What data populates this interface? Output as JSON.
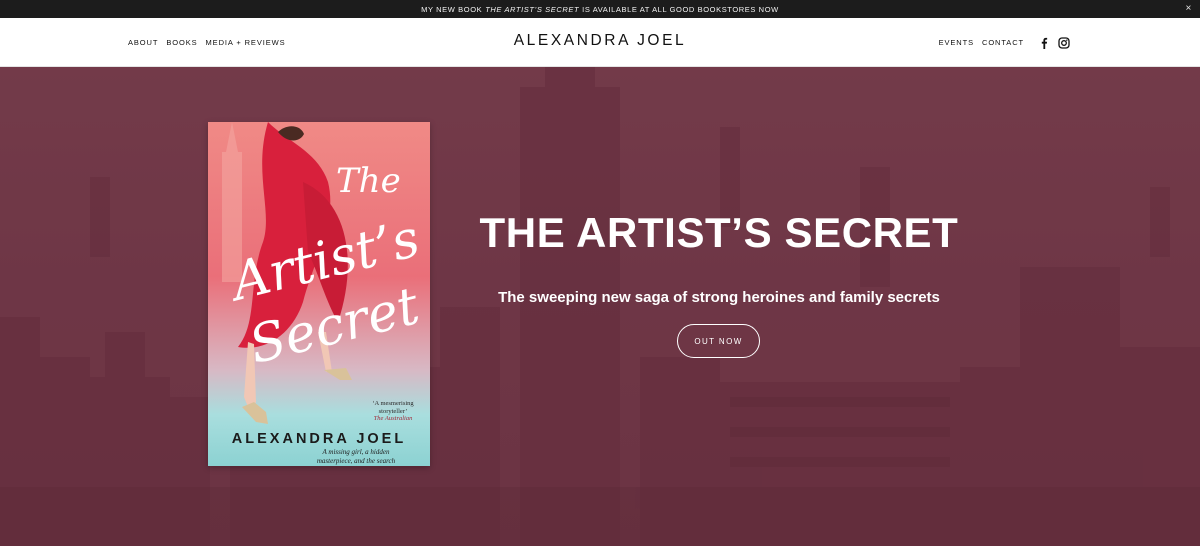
{
  "announcement": {
    "prefix": "MY NEW BOOK",
    "book": "THE ARTIST’S SECRET",
    "suffix": "IS AVAILABLE AT ALL GOOD BOOKSTORES NOW",
    "close_label": "×"
  },
  "header": {
    "nav_left": [
      "ABOUT",
      "BOOKS",
      "MEDIA + REVIEWS"
    ],
    "site_title": "ALEXANDRA JOEL",
    "nav_right": [
      "EVENTS",
      "CONTACT"
    ],
    "social_icons": [
      "facebook-icon",
      "instagram-icon"
    ]
  },
  "hero": {
    "title": "THE ARTIST’S SECRET",
    "subtitle": "The sweeping new saga of strong heroines and family secrets",
    "cta_label": "OUT NOW"
  },
  "cover": {
    "title_line1": "The",
    "title_line2": "Artist’s",
    "title_line3": "Secret",
    "quote": "‘A mesmerising storyteller’",
    "quote_source": "The Australian",
    "tagline": "A missing girl, a hidden masterpiece, and the search for the truth",
    "author": "ALEXANDRA JOEL"
  },
  "colors": {
    "accent_hero": "#6b3444",
    "announcement_bg": "#1c1c1c",
    "header_bg": "#ffffff",
    "cover_pink": "#e65e6f",
    "cover_teal": "#8fd3d3"
  }
}
